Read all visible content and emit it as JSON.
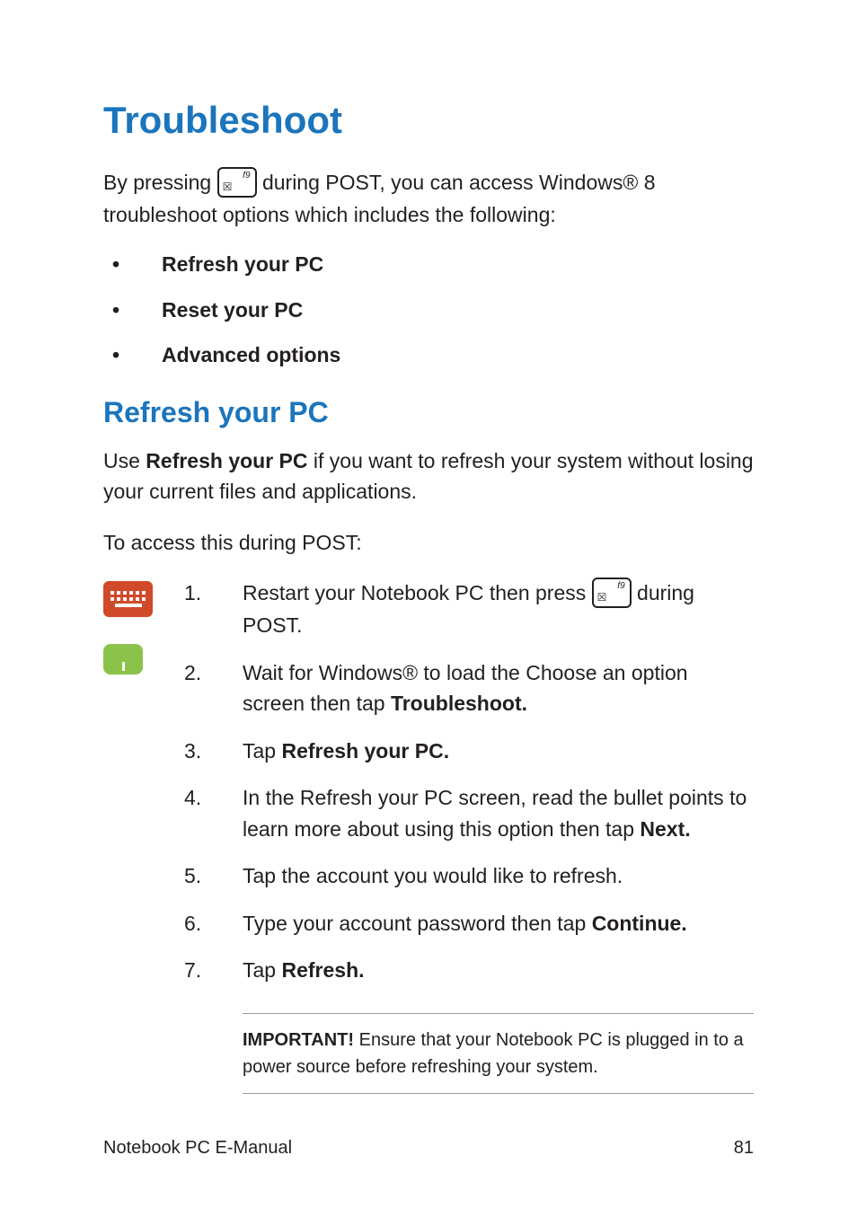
{
  "title": "Troubleshoot",
  "intro_part1": "By pressing ",
  "intro_part2": " during POST, you can access Windows® 8 troubleshoot options which includes the following:",
  "key_fn": "f9",
  "bullets": {
    "b1": "Refresh your PC",
    "b2": "Reset your PC",
    "b3": "Advanced options"
  },
  "section_title": "Refresh your PC",
  "section_intro_pre": "Use ",
  "section_intro_bold": "Refresh your PC",
  "section_intro_post": " if you want to refresh your system without losing your current files and applications.",
  "access_line": "To access this during POST:",
  "steps": {
    "s1_num": "1.",
    "s1_pre": "Restart your Notebook PC then press ",
    "s1_post": " during POST.",
    "s2_num": "2.",
    "s2_pre": "Wait for Windows® to load the Choose an option screen then tap ",
    "s2_bold": "Troubleshoot.",
    "s3_num": "3.",
    "s3_pre": "Tap ",
    "s3_bold": "Refresh your PC.",
    "s4_num": "4.",
    "s4_pre": "In the Refresh your PC screen, read the bullet points to learn more about using this option then tap ",
    "s4_bold": "Next.",
    "s5_num": "5.",
    "s5_txt": "Tap the account you would like to refresh.",
    "s6_num": "6.",
    "s6_pre": "Type your account password then tap ",
    "s6_bold": "Continue.",
    "s7_num": "7.",
    "s7_pre": "Tap ",
    "s7_bold": "Refresh."
  },
  "note_bold": "IMPORTANT!",
  "note_text": " Ensure that your Notebook PC is plugged in to a power source before refreshing your system.",
  "footer_left": "Notebook PC E-Manual",
  "footer_right": "81"
}
